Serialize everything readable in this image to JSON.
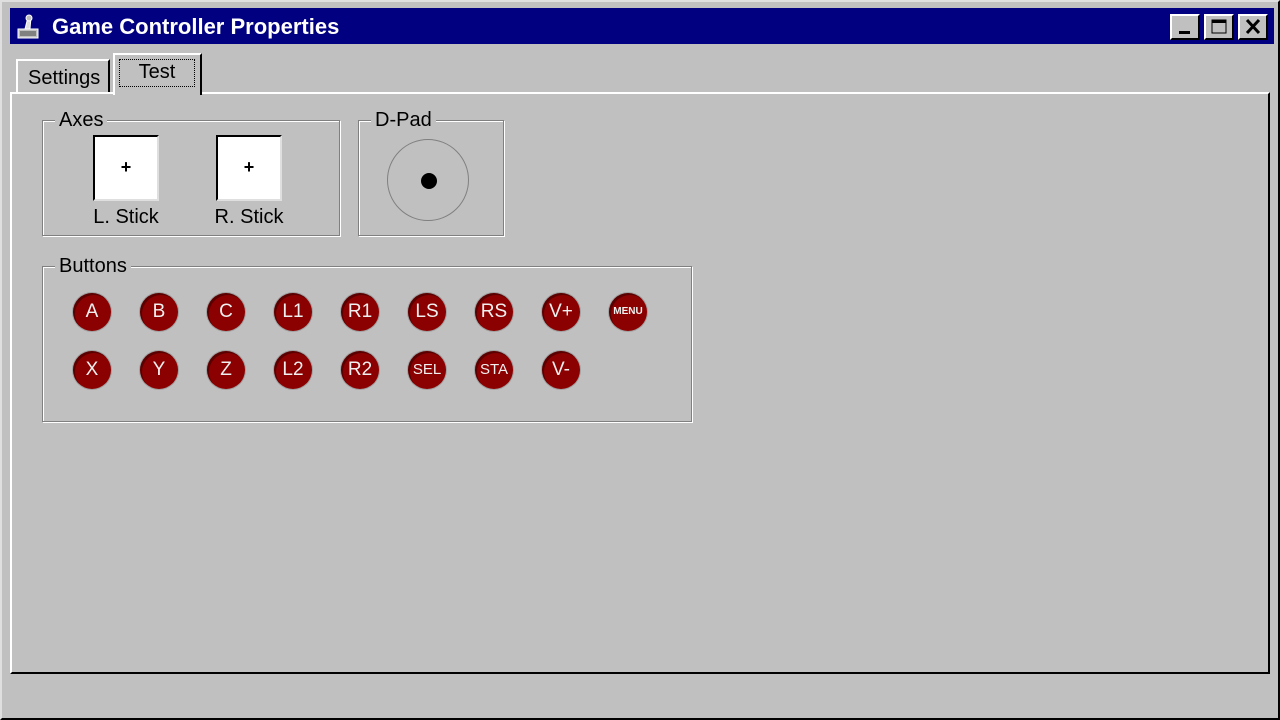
{
  "window": {
    "title": "Game Controller Properties"
  },
  "titlebar_buttons": [
    "minimize",
    "maximize",
    "close"
  ],
  "tabs": [
    {
      "label": "Settings",
      "active": false
    },
    {
      "label": "Test",
      "active": true
    }
  ],
  "axes": {
    "label": "Axes",
    "left_stick": {
      "label": "L. Stick",
      "marker": "+"
    },
    "right_stick": {
      "label": "R. Stick",
      "marker": "+"
    }
  },
  "dpad": {
    "label": "D-Pad"
  },
  "buttons": {
    "label": "Buttons",
    "row1": [
      "A",
      "B",
      "C",
      "L1",
      "R1",
      "LS",
      "RS",
      "V+",
      "MENU"
    ],
    "row2": [
      "X",
      "Y",
      "Z",
      "L2",
      "R2",
      "SEL",
      "STA",
      "V-"
    ]
  },
  "colors": {
    "titlebar": "#000080",
    "button_fill": "#8b0000",
    "face": "#c0c0c0"
  }
}
